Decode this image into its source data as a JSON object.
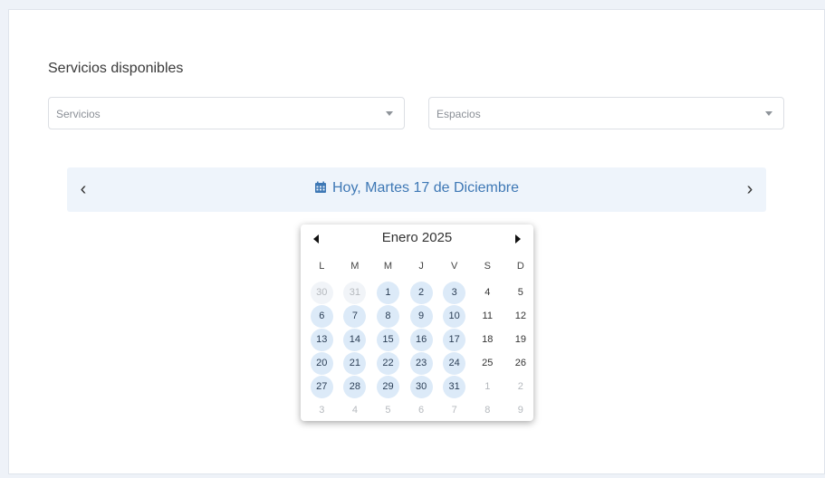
{
  "section_title": "Servicios disponibles",
  "selects": {
    "servicios_placeholder": "Servicios",
    "espacios_placeholder": "Espacios"
  },
  "daybar": {
    "prev_symbol": "‹",
    "next_symbol": "›",
    "label": "Hoy, Martes 17 de Diciembre",
    "accent": "#3e78b5"
  },
  "datepicker": {
    "month_label": "Enero 2025",
    "weekdays": [
      "L",
      "M",
      "M",
      "J",
      "V",
      "S",
      "D"
    ],
    "weeks": [
      [
        {
          "d": "30",
          "s": "muted-avail"
        },
        {
          "d": "31",
          "s": "muted-avail"
        },
        {
          "d": "1",
          "s": "avail"
        },
        {
          "d": "2",
          "s": "avail"
        },
        {
          "d": "3",
          "s": "avail"
        },
        {
          "d": "4",
          "s": "normal"
        },
        {
          "d": "5",
          "s": "normal"
        }
      ],
      [
        {
          "d": "6",
          "s": "avail"
        },
        {
          "d": "7",
          "s": "avail"
        },
        {
          "d": "8",
          "s": "avail"
        },
        {
          "d": "9",
          "s": "avail"
        },
        {
          "d": "10",
          "s": "avail"
        },
        {
          "d": "11",
          "s": "normal"
        },
        {
          "d": "12",
          "s": "normal"
        }
      ],
      [
        {
          "d": "13",
          "s": "avail"
        },
        {
          "d": "14",
          "s": "avail"
        },
        {
          "d": "15",
          "s": "avail"
        },
        {
          "d": "16",
          "s": "avail"
        },
        {
          "d": "17",
          "s": "avail"
        },
        {
          "d": "18",
          "s": "normal"
        },
        {
          "d": "19",
          "s": "normal"
        }
      ],
      [
        {
          "d": "20",
          "s": "avail"
        },
        {
          "d": "21",
          "s": "avail"
        },
        {
          "d": "22",
          "s": "avail"
        },
        {
          "d": "23",
          "s": "avail"
        },
        {
          "d": "24",
          "s": "avail"
        },
        {
          "d": "25",
          "s": "normal"
        },
        {
          "d": "26",
          "s": "normal"
        }
      ],
      [
        {
          "d": "27",
          "s": "avail"
        },
        {
          "d": "28",
          "s": "avail"
        },
        {
          "d": "29",
          "s": "avail"
        },
        {
          "d": "30",
          "s": "avail"
        },
        {
          "d": "31",
          "s": "avail"
        },
        {
          "d": "1",
          "s": "muted"
        },
        {
          "d": "2",
          "s": "muted"
        }
      ],
      [
        {
          "d": "3",
          "s": "muted"
        },
        {
          "d": "4",
          "s": "muted"
        },
        {
          "d": "5",
          "s": "muted"
        },
        {
          "d": "6",
          "s": "muted"
        },
        {
          "d": "7",
          "s": "muted"
        },
        {
          "d": "8",
          "s": "muted"
        },
        {
          "d": "9",
          "s": "muted"
        }
      ]
    ]
  }
}
